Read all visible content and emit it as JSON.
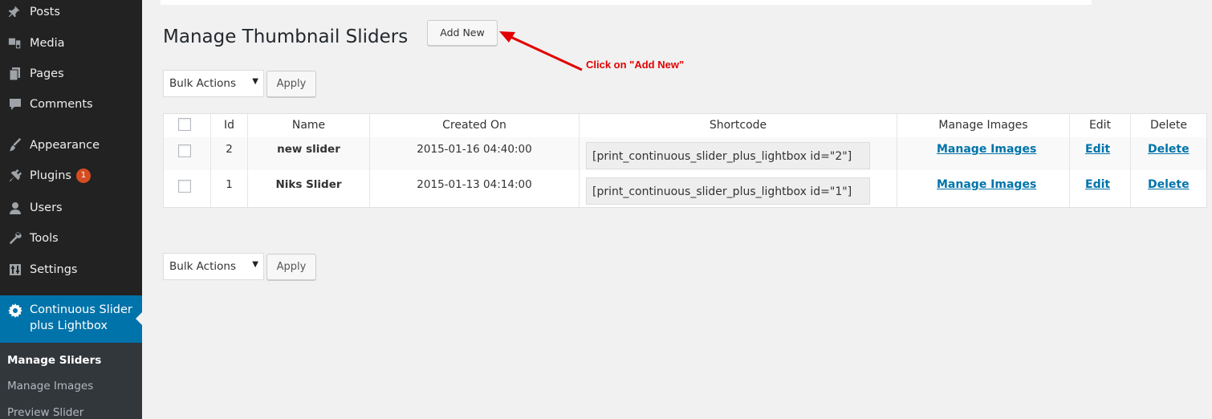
{
  "sidebar": {
    "items": [
      {
        "label": "Posts",
        "icon": "pin-icon"
      },
      {
        "label": "Media",
        "icon": "media-icon"
      },
      {
        "label": "Pages",
        "icon": "pages-icon"
      },
      {
        "label": "Comments",
        "icon": "comments-icon"
      },
      {
        "label": "Appearance",
        "icon": "brush-icon"
      },
      {
        "label": "Plugins",
        "icon": "plugin-icon",
        "badge": "1"
      },
      {
        "label": "Users",
        "icon": "user-icon"
      },
      {
        "label": "Tools",
        "icon": "wrench-icon"
      },
      {
        "label": "Settings",
        "icon": "settings-icon"
      }
    ],
    "current": {
      "label": "Continuous Slider plus Lightbox",
      "icon": "gear-icon"
    },
    "submenu": [
      "Manage Sliders",
      "Manage Images",
      "Preview Slider"
    ]
  },
  "header": {
    "title": "Manage Thumbnail Sliders",
    "add_new": "Add New"
  },
  "annotation": "Click on \"Add New\"",
  "bulk": {
    "label": "Bulk Actions",
    "apply": "Apply"
  },
  "table": {
    "headers": [
      "Id",
      "Name",
      "Created On",
      "Shortcode",
      "Manage Images",
      "Edit",
      "Delete"
    ],
    "rows": [
      {
        "id": "2",
        "name": "new slider",
        "created": "2015-01-16 04:40:00",
        "shortcode": "[print_continuous_slider_plus_lightbox id=\"2\"]",
        "manage": "Manage Images",
        "edit": "Edit",
        "delete": "Delete"
      },
      {
        "id": "1",
        "name": "Niks Slider",
        "created": "2015-01-13 04:14:00",
        "shortcode": "[print_continuous_slider_plus_lightbox id=\"1\"]",
        "manage": "Manage Images",
        "edit": "Edit",
        "delete": "Delete"
      }
    ]
  },
  "colors": {
    "sidebar_bg": "#222222",
    "active_bg": "#0073aa",
    "link": "#0073aa",
    "badge": "#d54e21",
    "annotation": "#e20000"
  }
}
